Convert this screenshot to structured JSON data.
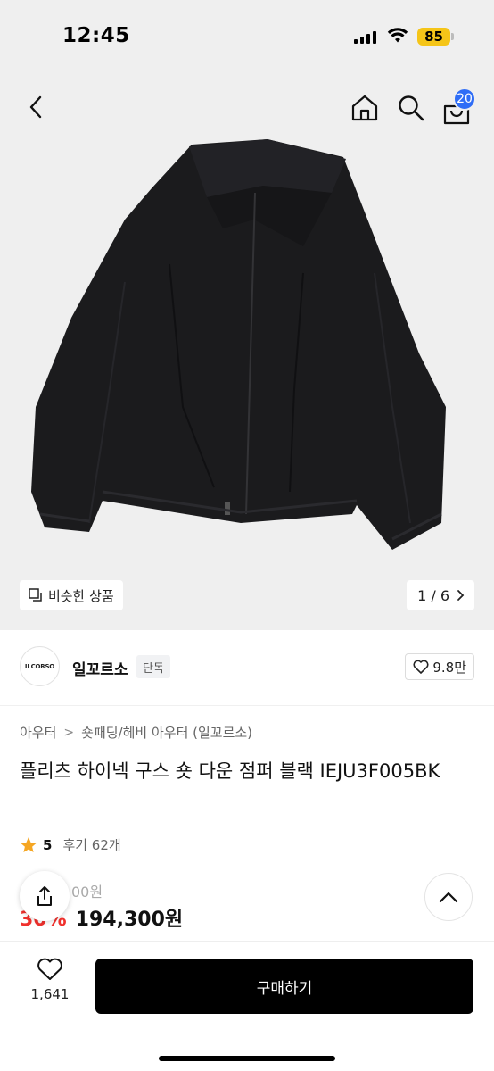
{
  "status_bar": {
    "time": "12:45",
    "battery": "85",
    "icons": [
      "signal-icon",
      "wifi-icon",
      "battery-icon"
    ]
  },
  "nav": {
    "icons": [
      "back-icon",
      "home-icon",
      "search-icon",
      "cart-icon"
    ],
    "cart_count": "20"
  },
  "gallery": {
    "similar_label": "비슷한 상품",
    "page": "1 / 6",
    "colors": {
      "background": "#efefef",
      "jacket": "#1b1b1d"
    }
  },
  "brand": {
    "logo_text": "ILCORSO",
    "name": "일꼬르소",
    "badge": "단독",
    "likes": "9.8만"
  },
  "breadcrumb": {
    "category": "아우터",
    "subcategory": "숏패딩/헤비 아우터 (일꼬르소)"
  },
  "product": {
    "title": "플리츠 하이넥 구스 숏 다운 점퍼 블랙 IEJU3F005BK",
    "rating": "5",
    "reviews": "후기 62개",
    "original_price": "00원",
    "discount": "30%",
    "sale_price": "194,300원"
  },
  "bottom": {
    "wish_count": "1,641",
    "buy_label": "구매하기"
  },
  "colors": {
    "accent_blue": "#2f6df6",
    "discount_red": "#f0312d",
    "star": "#f5a623",
    "battery": "#f5c518"
  }
}
